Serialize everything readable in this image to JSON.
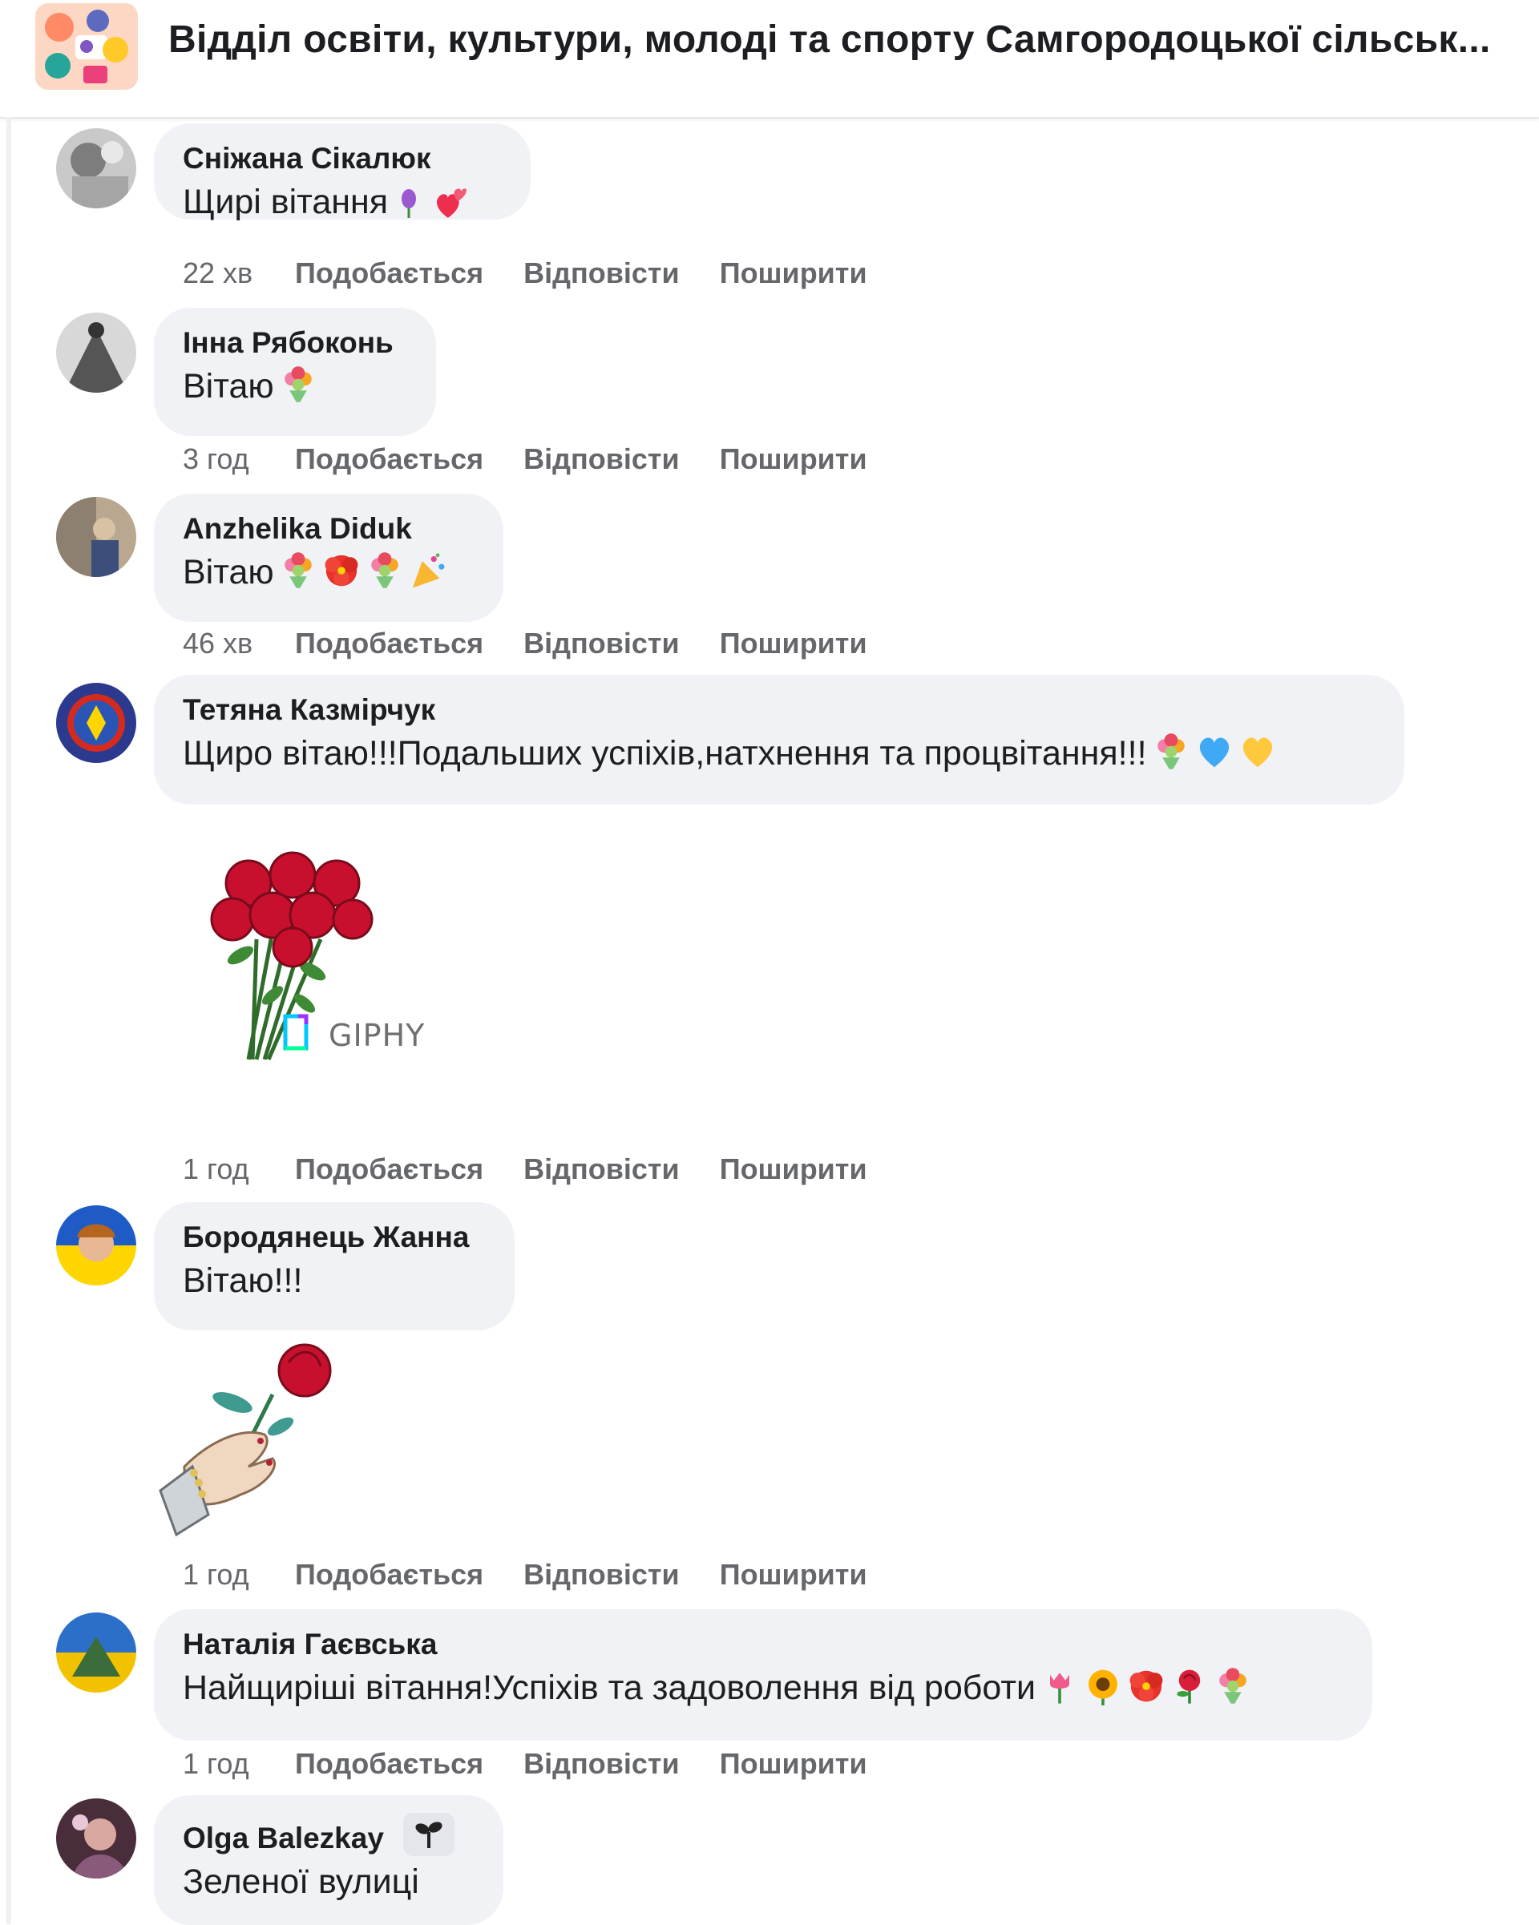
{
  "header": {
    "page_title": "Відділ освіти, культури, молоді та спорту Самгородоцької сільськ..."
  },
  "actions": {
    "like": "Подобається",
    "reply": "Відповісти",
    "share": "Поширити"
  },
  "comments": [
    {
      "author": "Сніжана Сікалюк",
      "text": "Щирі вітання",
      "emojis": [
        "purple-tulip",
        "two-hearts"
      ],
      "time": "22 хв"
    },
    {
      "author": "Інна Рябоконь",
      "text": "Вітаю",
      "emojis": [
        "bouquet"
      ],
      "time": "3 год"
    },
    {
      "author": "Anzhelika Diduk",
      "text": "Вітаю",
      "emojis": [
        "bouquet",
        "hibiscus",
        "bouquet",
        "party-popper"
      ],
      "time": "46 хв"
    },
    {
      "author": "Тетяна Казмірчук",
      "text": "Щиро вітаю!!!Подальших успіхів,натхнення та процвітання!!!",
      "emojis": [
        "bouquet",
        "blue-heart",
        "yellow-heart"
      ],
      "time": "1 год",
      "attachment": {
        "type": "gif",
        "icon": "rose-bouquet",
        "label": "GIPHY"
      }
    },
    {
      "author": "Бородянець Жанна",
      "text": "Вітаю!!!",
      "emojis": [],
      "time": "1 год",
      "attachment": {
        "type": "sticker",
        "icon": "hand-holding-rose"
      }
    },
    {
      "author": "Наталія Гаєвська",
      "text": "Найщиріші вітання!Успіхів та задоволення від роботи",
      "emojis": [
        "tulip",
        "sunflower",
        "hibiscus",
        "rose",
        "bouquet"
      ],
      "time": "1 год"
    },
    {
      "author": "Olga Balezkay",
      "text": "Зеленої вулиці",
      "emojis": [],
      "badge_icon": "seedling-icon"
    }
  ],
  "colors": {
    "bubble_bg": "#f0f2f5",
    "meta_text": "#65676b",
    "name_text": "#1c1e21",
    "rose_red": "#c8102e"
  }
}
